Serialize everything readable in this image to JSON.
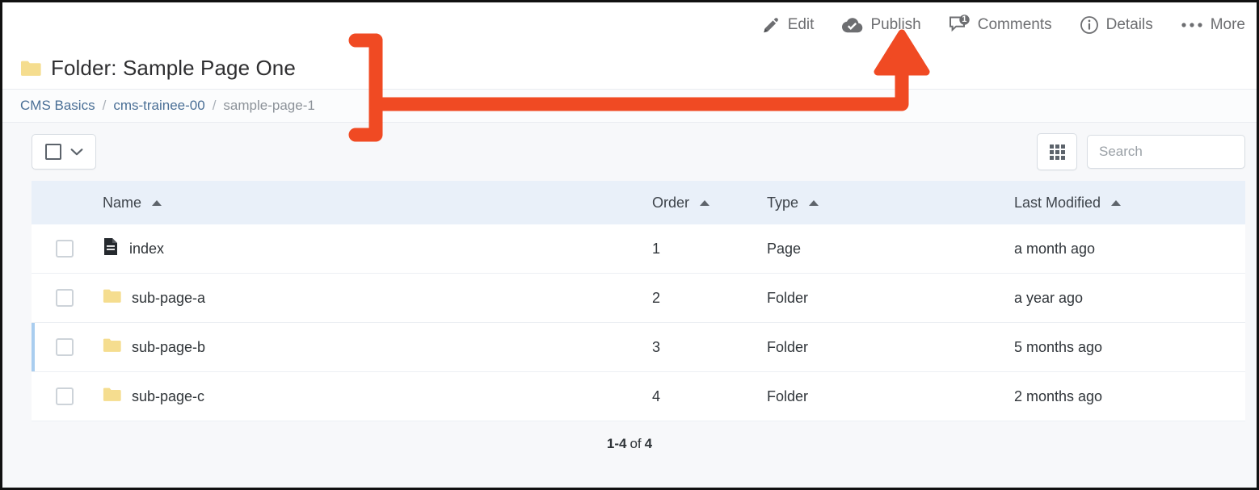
{
  "actionbar": {
    "items": [
      {
        "label": "Edit",
        "icon": "pencil-icon"
      },
      {
        "label": "Publish",
        "icon": "cloud-check-icon"
      },
      {
        "label": "Comments",
        "icon": "comment-bubble-icon",
        "badge": "1"
      },
      {
        "label": "Details",
        "icon": "info-circle-icon"
      },
      {
        "label": "More",
        "icon": "ellipsis-icon"
      }
    ]
  },
  "header": {
    "icon": "folder-icon",
    "title": "Folder: Sample Page One"
  },
  "breadcrumb": {
    "separator": "/",
    "items": [
      {
        "label": "CMS Basics",
        "type": "link"
      },
      {
        "label": "cms-trainee-00",
        "type": "link"
      },
      {
        "label": "sample-page-1",
        "type": "current"
      }
    ]
  },
  "toolbar": {
    "select_all": {
      "icon": "checkbox-icon",
      "chevron": "chevron-down-icon"
    },
    "grid_view": {
      "icon": "grid-icon"
    },
    "search": {
      "placeholder": "Search",
      "value": ""
    }
  },
  "table": {
    "columns": [
      {
        "key": "check",
        "label": ""
      },
      {
        "key": "name",
        "label": "Name",
        "sort": "asc"
      },
      {
        "key": "order",
        "label": "Order",
        "sort": "asc"
      },
      {
        "key": "type",
        "label": "Type",
        "sort": "asc"
      },
      {
        "key": "mod",
        "label": "Last Modified",
        "sort": "asc"
      }
    ],
    "rows": [
      {
        "icon": "document-icon",
        "name": "index",
        "order": "1",
        "type": "Page",
        "modified": "a month ago",
        "accent": false
      },
      {
        "icon": "folder-icon",
        "name": "sub-page-a",
        "order": "2",
        "type": "Folder",
        "modified": "a year ago",
        "accent": false
      },
      {
        "icon": "folder-icon",
        "name": "sub-page-b",
        "order": "3",
        "type": "Folder",
        "modified": "5 months ago",
        "accent": true
      },
      {
        "icon": "folder-icon",
        "name": "sub-page-c",
        "order": "4",
        "type": "Folder",
        "modified": "2 months ago",
        "accent": false
      }
    ]
  },
  "pagination": {
    "range": "1-4",
    "of": "of",
    "total": "4"
  },
  "annotation": {
    "color": "#f04a23",
    "shape": "brace-to-arrow",
    "points_at": "Publish"
  },
  "colors": {
    "accent_blue": "#4a6f96",
    "table_header_bg": "#e9f0f9",
    "page_bg": "#f7f8fa",
    "folder_yellow": "#f5dd8f",
    "annotation_red": "#f04a23",
    "row_accent": "#a9cdef"
  }
}
